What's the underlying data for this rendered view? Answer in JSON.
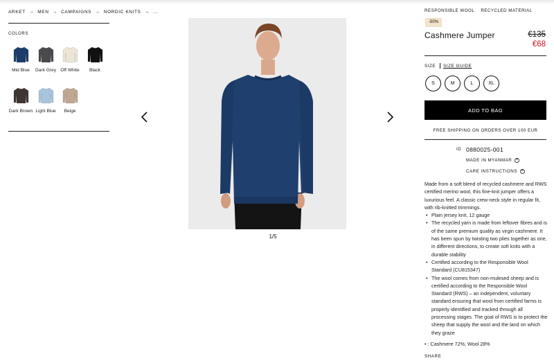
{
  "breadcrumb": {
    "items": [
      "ARKET",
      "MEN",
      "CAMPAIGNS",
      "NORDIC KNITS",
      "..."
    ]
  },
  "colors": {
    "heading": "COLORS",
    "swatches": [
      {
        "label": "Mid Blue",
        "color": "#1d3c6b"
      },
      {
        "label": "Dark Grey",
        "color": "#4a4a4c"
      },
      {
        "label": "Off White",
        "color": "#ebe6d8"
      },
      {
        "label": "Black",
        "color": "#111114"
      },
      {
        "label": "Dark Brown",
        "color": "#3d3633"
      },
      {
        "label": "Light Blue",
        "color": "#a9c4dd"
      },
      {
        "label": "Beige",
        "color": "#bfa791"
      }
    ]
  },
  "gallery": {
    "pager": "1/5",
    "prev_icon": "chevron-left-icon",
    "next_icon": "chevron-right-icon"
  },
  "product": {
    "tags": [
      "RESPONSIBLE WOOL",
      "RECYCLED MATERIAL"
    ],
    "discount": "-50%",
    "name": "Cashmere Jumper",
    "price_old": "€135",
    "price_new": "€68",
    "sale_color": "#d0101e"
  },
  "size": {
    "heading": "SIZE",
    "guide": "SIZE GUIDE",
    "options": [
      "S",
      "M",
      "L",
      "XL"
    ]
  },
  "actions": {
    "add_to_bag": "ADD TO BAG",
    "free_shipping": "FREE SHIPPING ON ORDERS OVER 100 EUR"
  },
  "details": {
    "id_label": "ID",
    "id_value": "0880025-001",
    "made_in": "MADE IN MYANMAR",
    "care": "CARE INSTRUCTIONS",
    "plus_symbol": "+"
  },
  "description": {
    "intro": "Made from a soft blend of recycled cashmere and RWS certified merino wool, this fine-knit jumper offers a luxurious feel. A classic crew-neck style in regular fit, with rib-knitted trimmings.",
    "bullets": [
      "Plain jersey knit, 12 gauge",
      "The recycled yarn is made from leftover fibres and is of the same premium quality as virgin cashmere. It has been spun by twisting two plies together as one, in different directions, to create soft knits with a durable stability",
      "Certified according to the Responsible Wool Standard (CU815347)",
      "The wool comes from non-mulesed sheep and is certified according to the Responsible Wool Standard (RWS) – an independent, voluntary standard ensuring that wool from certified farms is properly identified and tracked through all processing stages. The goal of RWS is to protect the sheep that supply the wool and the land on which they graze"
    ],
    "composition": ": Cashmere 72%, Wool 28%"
  },
  "share": "SHARE"
}
